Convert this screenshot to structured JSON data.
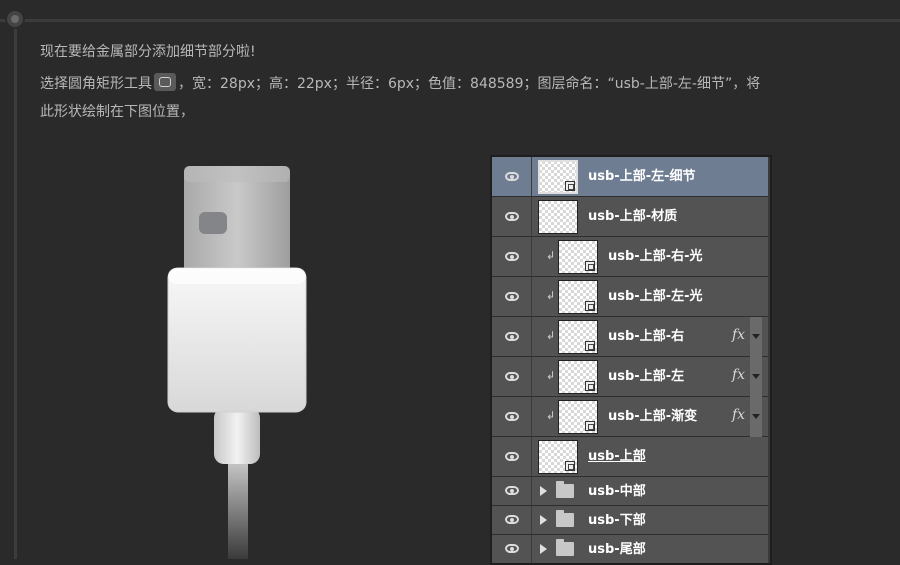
{
  "instructions": {
    "line1": "现在要给金属部分添加细节部分啦!",
    "line2_a": "选择圆角矩形工具",
    "line2_b": "，宽：28px；高：22px；半径：6px；色值：848589；图层命名：“usb-上部-左-细节”，将",
    "line3": "此形状绘制在下图位置，"
  },
  "layers": [
    {
      "name": "usb-上部-左-细节",
      "selected": true,
      "clipped": false,
      "fx": false
    },
    {
      "name": "usb-上部-材质",
      "selected": false,
      "clipped": false,
      "fx": false
    },
    {
      "name": "usb-上部-右-光",
      "selected": false,
      "clipped": true,
      "fx": false
    },
    {
      "name": "usb-上部-左-光",
      "selected": false,
      "clipped": true,
      "fx": false
    },
    {
      "name": "usb-上部-右",
      "selected": false,
      "clipped": true,
      "fx": true
    },
    {
      "name": "usb-上部-左",
      "selected": false,
      "clipped": true,
      "fx": true
    },
    {
      "name": "usb-上部-渐变",
      "selected": false,
      "clipped": true,
      "fx": true
    },
    {
      "name": "usb-上部",
      "selected": false,
      "clipped": false,
      "fx": false,
      "underline": true
    }
  ],
  "groups": [
    "usb-中部",
    "usb-下部",
    "usb-尾部"
  ],
  "fx_label": "fx",
  "clip_glyph": "↲",
  "colors": {
    "selected_row": "#6f7d93",
    "row": "#535353",
    "detail_rect": "#848589"
  }
}
